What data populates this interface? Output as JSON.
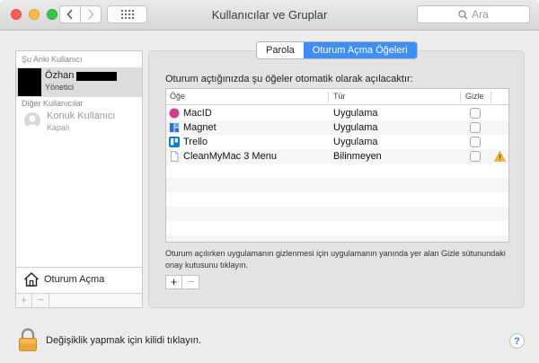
{
  "window": {
    "title": "Kullanıcılar ve Gruplar"
  },
  "search": {
    "placeholder": "Ara"
  },
  "sidebar": {
    "current_header": "Şu Anki Kullanıcı",
    "current_user": {
      "name": "Özhan",
      "role": "Yönetici"
    },
    "other_header": "Diğer Kullanıcılar",
    "guest": {
      "name": "Konuk Kullanıcı",
      "status": "Kapalı"
    },
    "login_options_label": "Oturum Açma",
    "add_symbol": "+",
    "remove_symbol": "−"
  },
  "tabs": [
    {
      "label": "Parola",
      "active": false
    },
    {
      "label": "Oturum Açma Öğeleri",
      "active": true
    }
  ],
  "main": {
    "intro": "Oturum açtığınızda şu öğeler otomatik olarak açılacaktır:",
    "columns": {
      "item": "Öğe",
      "type": "Tür",
      "hide": "Gizle"
    },
    "items": [
      {
        "name": "MacID",
        "type": "Uygulama",
        "icon": "macid-icon",
        "hidden": false,
        "warning": false
      },
      {
        "name": "Magnet",
        "type": "Uygulama",
        "icon": "magnet-icon",
        "hidden": false,
        "warning": false
      },
      {
        "name": "Trello",
        "type": "Uygulama",
        "icon": "trello-icon",
        "hidden": false,
        "warning": false
      },
      {
        "name": "CleanMyMac 3 Menu",
        "type": "Bilinmeyen",
        "icon": "document-icon",
        "hidden": false,
        "warning": true
      }
    ],
    "hint": "Oturum açılırken uygulamanın gizlenmesi için uygulamanın yanında yer alan Gizle sütunundaki onay kutusunu tıklayın.",
    "add_symbol": "+",
    "remove_symbol": "−"
  },
  "footer": {
    "lock_text": "Değişiklik yapmak için kilidi tıklayın.",
    "help_symbol": "?"
  },
  "colors": {
    "accent": "#3d8ef7",
    "close": "#fc605c",
    "minimize": "#fdbc40",
    "maximize": "#34c84a"
  }
}
